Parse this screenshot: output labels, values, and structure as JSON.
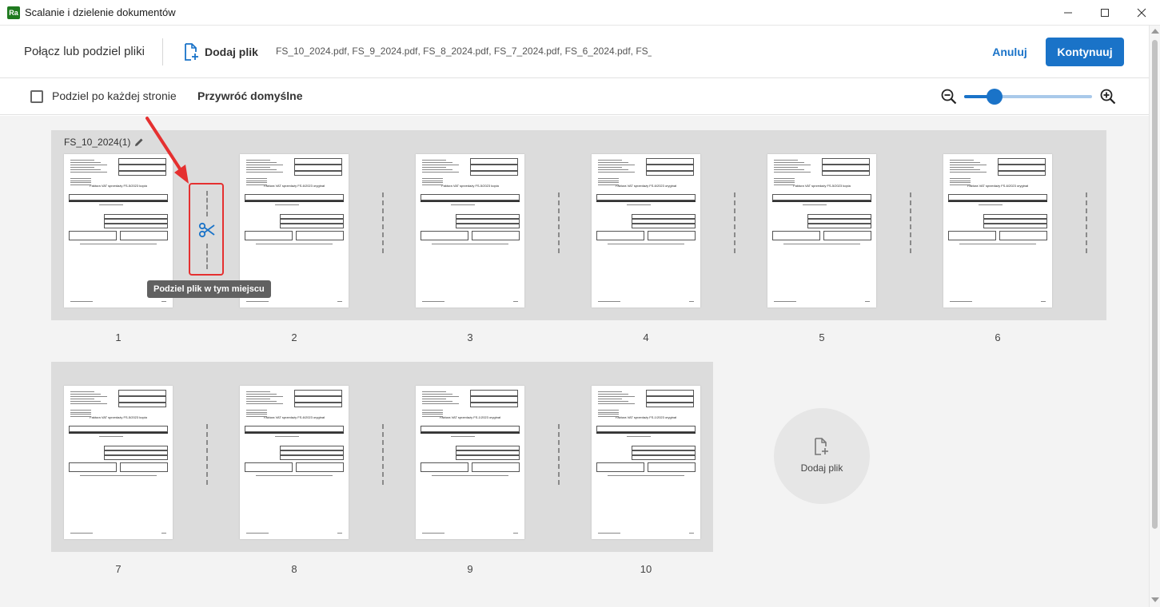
{
  "window": {
    "app_icon": "Ra",
    "title": "Scalanie i dzielenie dokumentów"
  },
  "header": {
    "title": "Połącz lub podziel pliki",
    "add_file_label": "Dodaj plik",
    "files_list": "FS_10_2024.pdf, FS_9_2024.pdf, FS_8_2024.pdf, FS_7_2024.pdf, FS_6_2024.pdf, FS_...",
    "cancel_label": "Anuluj",
    "continue_label": "Kontynuuj"
  },
  "toolbar": {
    "split_each_page_label": "Podziel po każdej stronie",
    "split_each_page_checked": false,
    "reset_label": "Przywróć domyślne",
    "zoom_level": 0.2
  },
  "document": {
    "group_name": "FS_10_2024(1)",
    "pages": [
      {
        "number": "1",
        "title": "Faktura VAT sprzedaży FS-5/2023 kopia"
      },
      {
        "number": "2",
        "title": "Faktura VAT sprzedaży FS-6/2023 oryginał"
      },
      {
        "number": "3",
        "title": "Faktura VAT sprzedaży FS-5/2023 kopia"
      },
      {
        "number": "4",
        "title": "Faktura VAT sprzedaży FS-6/2023 oryginał"
      },
      {
        "number": "5",
        "title": "Faktura VAT sprzedaży FS-5/2023 kopia"
      },
      {
        "number": "6",
        "title": "Faktura VAT sprzedaży FS-6/2023 oryginał"
      },
      {
        "number": "7",
        "title": "Faktura VAT sprzedaży FS-5/2023 kopia"
      },
      {
        "number": "8",
        "title": "Faktura VAT sprzedaży FS-6/2023 oryginał"
      },
      {
        "number": "9",
        "title": "Faktura VAT sprzedaży FS-1/2023 oryginał"
      },
      {
        "number": "10",
        "title": "Faktura VAT sprzedaży FS-1/2023 oryginał"
      }
    ]
  },
  "split_tooltip": "Podziel plik w tym miejscu",
  "add_file_tile_label": "Dodaj plik",
  "icons": {
    "add_file": "file-plus-icon",
    "edit": "pencil-icon",
    "scissors": "scissors-icon",
    "zoom_out": "zoom-out-icon",
    "zoom_in": "zoom-in-icon"
  },
  "colors": {
    "accent": "#1a73c8",
    "highlight": "#e53030",
    "tooltip_bg": "#616161"
  }
}
